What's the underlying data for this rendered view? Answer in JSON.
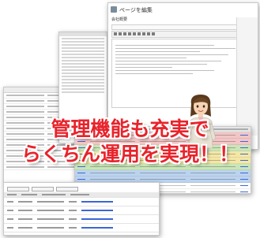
{
  "editor": {
    "page_title": "ページを編集",
    "subtitle": "会社概要"
  },
  "headline": {
    "line1": "管理機能も充実で",
    "line2": "らくちん運用を実現！！"
  },
  "colors": {
    "headline": "#e8232b",
    "row_pink": "#f3c6c6",
    "row_green": "#c9e6b8",
    "row_yellow": "#f4e7a6",
    "row_blue": "#bcd3ef"
  }
}
